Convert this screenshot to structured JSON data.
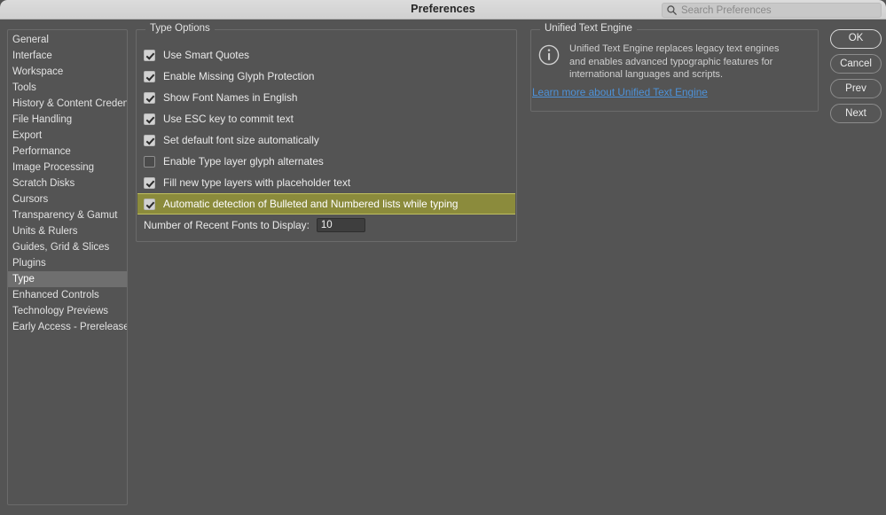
{
  "titlebar": {
    "title": "Preferences",
    "search_icon": "search-icon",
    "search_value": "",
    "search_placeholder": "Search Preferences"
  },
  "sidebar": {
    "items": [
      {
        "label": "General",
        "selected": false
      },
      {
        "label": "Interface",
        "selected": false
      },
      {
        "label": "Workspace",
        "selected": false
      },
      {
        "label": "Tools",
        "selected": false
      },
      {
        "label": "History & Content Credentials",
        "selected": false
      },
      {
        "label": "File Handling",
        "selected": false
      },
      {
        "label": "Export",
        "selected": false
      },
      {
        "label": "Performance",
        "selected": false
      },
      {
        "label": "Image Processing",
        "selected": false
      },
      {
        "label": "Scratch Disks",
        "selected": false
      },
      {
        "label": "Cursors",
        "selected": false
      },
      {
        "label": "Transparency & Gamut",
        "selected": false
      },
      {
        "label": "Units & Rulers",
        "selected": false
      },
      {
        "label": "Guides, Grid & Slices",
        "selected": false
      },
      {
        "label": "Plugins",
        "selected": false
      },
      {
        "label": "Type",
        "selected": true
      },
      {
        "label": "Enhanced Controls",
        "selected": false
      },
      {
        "label": "Technology Previews",
        "selected": false
      },
      {
        "label": "Early Access - Prerelease",
        "selected": false
      }
    ]
  },
  "type_options": {
    "title": "Type Options",
    "checkboxes": [
      {
        "label": "Use Smart Quotes",
        "checked": true,
        "highlighted": false
      },
      {
        "label": "Enable Missing Glyph Protection",
        "checked": true,
        "highlighted": false
      },
      {
        "label": "Show Font Names in English",
        "checked": true,
        "highlighted": false
      },
      {
        "label": "Use ESC key to commit text",
        "checked": true,
        "highlighted": false
      },
      {
        "label": "Set default font size automatically",
        "checked": true,
        "highlighted": false
      },
      {
        "label": "Enable Type layer glyph alternates",
        "checked": false,
        "highlighted": false
      },
      {
        "label": "Fill new type layers with placeholder text",
        "checked": true,
        "highlighted": false
      },
      {
        "label": "Automatic detection of Bulleted and Numbered lists while typing",
        "checked": true,
        "highlighted": true
      }
    ],
    "recent_fonts_label": "Number of Recent Fonts to Display:",
    "recent_fonts_value": "10"
  },
  "unified_text_engine": {
    "title": "Unified Text Engine",
    "info_icon": "info-circle-icon",
    "description": "Unified Text Engine replaces legacy text engines and enables advanced typographic features for international languages and scripts.",
    "link_label": "Learn more about Unified Text Engine"
  },
  "buttons": [
    {
      "label": "OK",
      "default": true
    },
    {
      "label": "Cancel",
      "default": false
    },
    {
      "label": "Prev",
      "default": false
    },
    {
      "label": "Next",
      "default": false
    }
  ],
  "colors": {
    "window_bg": "#545454",
    "titlebar_bg": "#d4d4d4",
    "highlight_row": "#8b8b3c",
    "sidebar_selected": "#6f6f6f",
    "link": "#4d92d9",
    "border": "#6a6a6a"
  }
}
